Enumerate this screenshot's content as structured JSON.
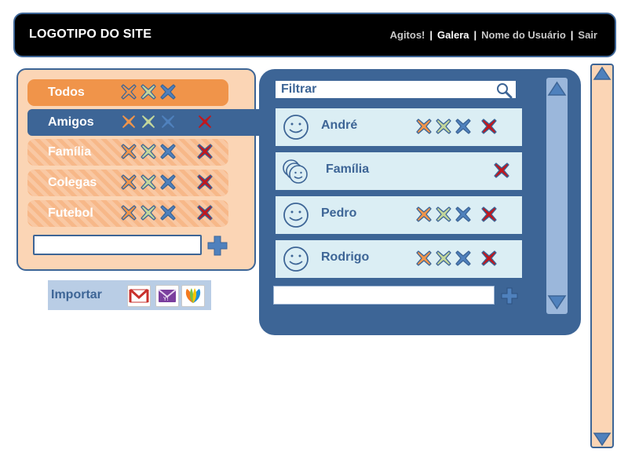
{
  "header": {
    "logo": "LOGOTIPO DO SITE",
    "nav": [
      {
        "label": "Agitos!"
      },
      {
        "label": "Galera"
      },
      {
        "label": "Nome do Usuário"
      },
      {
        "label": "Sair"
      }
    ],
    "separator": "|"
  },
  "groups": [
    {
      "label": "Todos",
      "style": "active-orange",
      "actions": [
        "remove-orange",
        "remove-green",
        "remove-blue"
      ]
    },
    {
      "label": "Amigos",
      "style": "selected",
      "actions": [
        "remove-orange",
        "remove-green",
        "remove-blue",
        "delete-red"
      ]
    },
    {
      "label": "Família",
      "style": "hatched",
      "actions": [
        "remove-orange",
        "remove-green",
        "remove-blue",
        "delete-red"
      ]
    },
    {
      "label": "Colegas",
      "style": "hatched",
      "actions": [
        "remove-orange",
        "remove-green",
        "remove-blue",
        "delete-red"
      ]
    },
    {
      "label": "Futebol",
      "style": "hatched",
      "actions": [
        "remove-orange",
        "remove-green",
        "remove-blue",
        "delete-red"
      ]
    }
  ],
  "new_group": {
    "value": ""
  },
  "import": {
    "label": "Importar",
    "services": [
      "gmail-icon",
      "yahoo-icon",
      "msn-icon"
    ]
  },
  "filter": {
    "label": "Filtrar"
  },
  "contacts": [
    {
      "name": "André",
      "avatar": "smiley-icon",
      "actions": [
        "remove-orange",
        "remove-green",
        "remove-blue",
        "delete-red"
      ]
    },
    {
      "name": "Família",
      "avatar": "group-smiley-icon",
      "actions": [
        "delete-red"
      ]
    },
    {
      "name": "Pedro",
      "avatar": "smiley-icon",
      "actions": [
        "remove-orange",
        "remove-green",
        "remove-blue",
        "delete-red"
      ]
    },
    {
      "name": "Rodrigo",
      "avatar": "smiley-icon",
      "actions": [
        "remove-orange",
        "remove-green",
        "remove-blue",
        "delete-red"
      ]
    }
  ],
  "new_contact": {
    "value": ""
  },
  "colors": {
    "brand_blue": "#3d6596",
    "orange": "#f0944a",
    "peach": "#fbd5b5",
    "light_blue": "#dbeef4",
    "red": "#c0171d",
    "green": "#9bbb59",
    "blue_x": "#4f81bd"
  }
}
